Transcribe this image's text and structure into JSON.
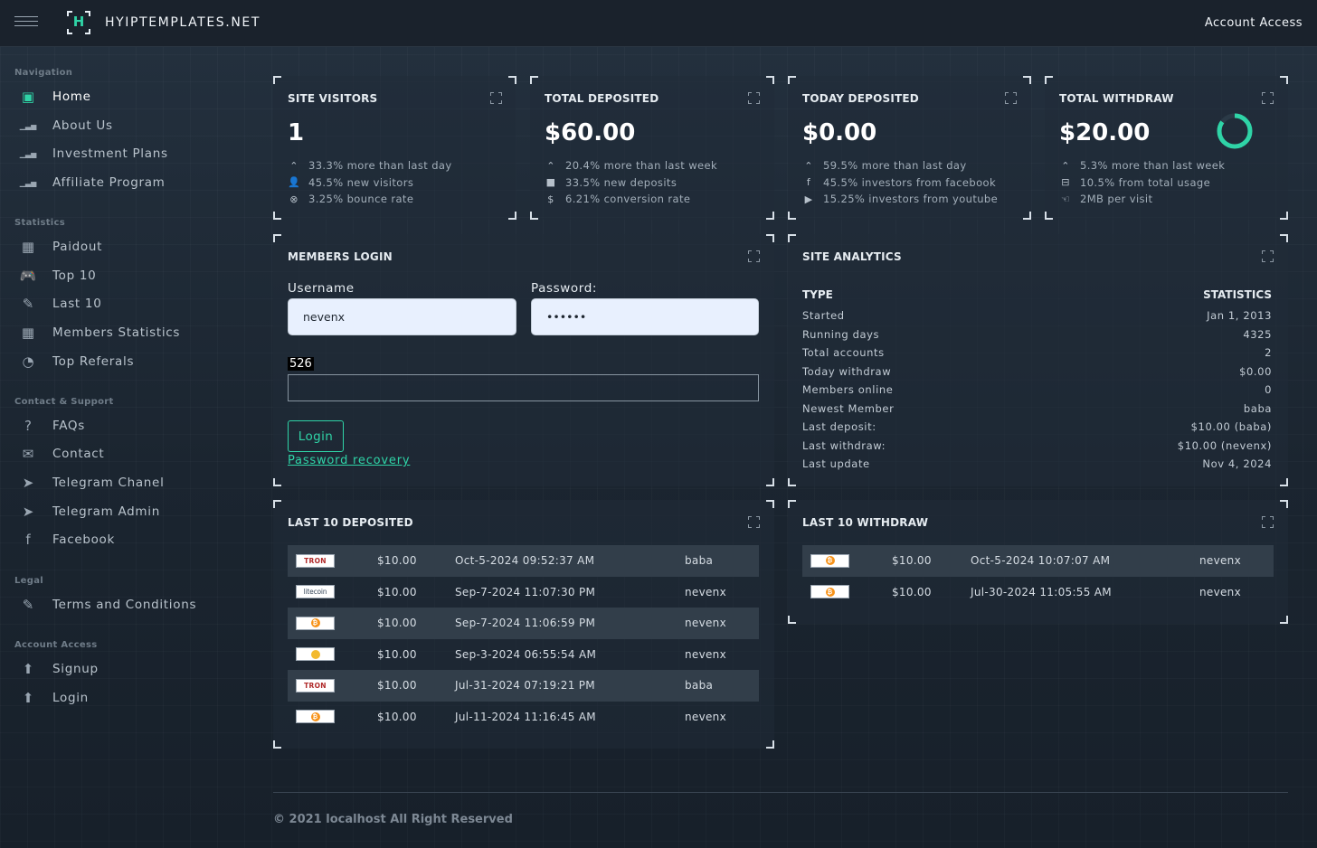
{
  "header": {
    "brand": "HYIPTEMPLATES.NET",
    "logo_letter": "H",
    "account_access": "Account Access"
  },
  "sidebar": {
    "sections": [
      {
        "title": "Navigation",
        "items": [
          {
            "label": "Home",
            "icon": "chip-icon",
            "active": true
          },
          {
            "label": "About Us",
            "icon": "bar-chart-icon"
          },
          {
            "label": "Investment Plans",
            "icon": "bar-chart-icon"
          },
          {
            "label": "Affiliate Program",
            "icon": "bar-chart-icon"
          }
        ]
      },
      {
        "title": "Statistics",
        "items": [
          {
            "label": "Paidout",
            "icon": "dashboard-icon"
          },
          {
            "label": "Top 10",
            "icon": "gamepad-icon"
          },
          {
            "label": "Last 10",
            "icon": "pencil-icon"
          },
          {
            "label": "Members Statistics",
            "icon": "grid-icon"
          },
          {
            "label": "Top Referals",
            "icon": "pie-chart-icon"
          }
        ]
      },
      {
        "title": "Contact & Support",
        "items": [
          {
            "label": "FAQs",
            "icon": "question-icon"
          },
          {
            "label": "Contact",
            "icon": "mail-icon"
          },
          {
            "label": "Telegram Chanel",
            "icon": "telegram-icon"
          },
          {
            "label": "Telegram Admin",
            "icon": "send-icon"
          },
          {
            "label": "Facebook",
            "icon": "facebook-icon"
          }
        ]
      },
      {
        "title": "Legal",
        "items": [
          {
            "label": "Terms and Conditions",
            "icon": "pen-icon"
          }
        ]
      },
      {
        "title": "Account Access",
        "items": [
          {
            "label": "Signup",
            "icon": "arrow-up-circle-icon"
          },
          {
            "label": "Login",
            "icon": "arrow-up-circle-icon"
          }
        ]
      }
    ]
  },
  "stats": [
    {
      "title": "SITE VISITORS",
      "value": "1",
      "lines": [
        {
          "icon": "chevron-up-icon",
          "text": "33.3% more than last day"
        },
        {
          "icon": "user-icon",
          "text": "45.5% new visitors"
        },
        {
          "icon": "close-circle-icon",
          "text": "3.25% bounce rate"
        }
      ]
    },
    {
      "title": "TOTAL DEPOSITED",
      "value": "$60.00",
      "lines": [
        {
          "icon": "chevron-up-icon",
          "text": "20.4% more than last week"
        },
        {
          "icon": "bag-icon",
          "text": "33.5% new deposits"
        },
        {
          "icon": "dollar-icon",
          "text": "6.21% conversion rate"
        }
      ]
    },
    {
      "title": "TODAY DEPOSITED",
      "value": "$0.00",
      "lines": [
        {
          "icon": "chevron-up-icon",
          "text": "59.5% more than last day"
        },
        {
          "icon": "facebook-icon",
          "text": "45.5% investors from facebook"
        },
        {
          "icon": "youtube-icon",
          "text": "15.25% investors from youtube"
        }
      ]
    },
    {
      "title": "TOTAL WITHDRAW",
      "value": "$20.00",
      "progress": 0.85,
      "lines": [
        {
          "icon": "chevron-up-icon",
          "text": "5.3% more than last week"
        },
        {
          "icon": "drive-icon",
          "text": "10.5% from total usage"
        },
        {
          "icon": "hand-icon",
          "text": "2MB per visit"
        }
      ]
    }
  ],
  "login": {
    "title": "MEMBERS LOGIN",
    "username_label": "Username",
    "username_value": "nevenx",
    "password_label": "Password:",
    "password_value": "••••••",
    "captcha": "526",
    "captcha_value": "",
    "button": "Login",
    "recovery": "Password recovery"
  },
  "analytics": {
    "title": "SITE ANALYTICS",
    "col_type": "TYPE",
    "col_stats": "STATISTICS",
    "rows": [
      {
        "k": "Started",
        "v": "Jan 1, 2013"
      },
      {
        "k": "Running days",
        "v": "4325"
      },
      {
        "k": "Total accounts",
        "v": "2"
      },
      {
        "k": "Today withdraw",
        "v": "$0.00"
      },
      {
        "k": "Members online",
        "v": "0"
      },
      {
        "k": "Newest Member",
        "v": "baba"
      },
      {
        "k": "Last deposit:",
        "v": "$10.00 (baba)"
      },
      {
        "k": "Last withdraw:",
        "v": "$10.00 (nevenx)"
      },
      {
        "k": "Last update",
        "v": "Nov 4, 2024"
      }
    ]
  },
  "deposits": {
    "title": "LAST 10 DEPOSITED",
    "rows": [
      {
        "coin": "tron",
        "coin_text": "TRON",
        "amount": "$10.00",
        "date": "Oct-5-2024 09:52:37 AM",
        "user": "baba"
      },
      {
        "coin": "litecoin",
        "coin_text": "litecoin",
        "amount": "$10.00",
        "date": "Sep-7-2024 11:07:30 PM",
        "user": "nevenx"
      },
      {
        "coin": "bitcoin",
        "coin_text": "₿",
        "amount": "$10.00",
        "date": "Sep-7-2024 11:06:59 PM",
        "user": "nevenx"
      },
      {
        "coin": "bnb",
        "coin_text": "",
        "amount": "$10.00",
        "date": "Sep-3-2024 06:55:54 AM",
        "user": "nevenx"
      },
      {
        "coin": "tron",
        "coin_text": "TRON",
        "amount": "$10.00",
        "date": "Jul-31-2024 07:19:21 PM",
        "user": "baba"
      },
      {
        "coin": "bitcoin",
        "coin_text": "₿",
        "amount": "$10.00",
        "date": "Jul-11-2024 11:16:45 AM",
        "user": "nevenx"
      }
    ]
  },
  "withdrawals": {
    "title": "LAST 10 WITHDRAW",
    "rows": [
      {
        "coin": "bitcoin",
        "coin_text": "₿",
        "amount": "$10.00",
        "date": "Oct-5-2024 10:07:07 AM",
        "user": "nevenx"
      },
      {
        "coin": "bitcoin",
        "coin_text": "₿",
        "amount": "$10.00",
        "date": "Jul-30-2024 11:05:55 AM",
        "user": "nevenx"
      }
    ]
  },
  "footer": {
    "text": "© 2021 localhost All Right Reserved"
  },
  "colors": {
    "accent": "#2fd4a7",
    "panel_border": "#3a4653"
  }
}
